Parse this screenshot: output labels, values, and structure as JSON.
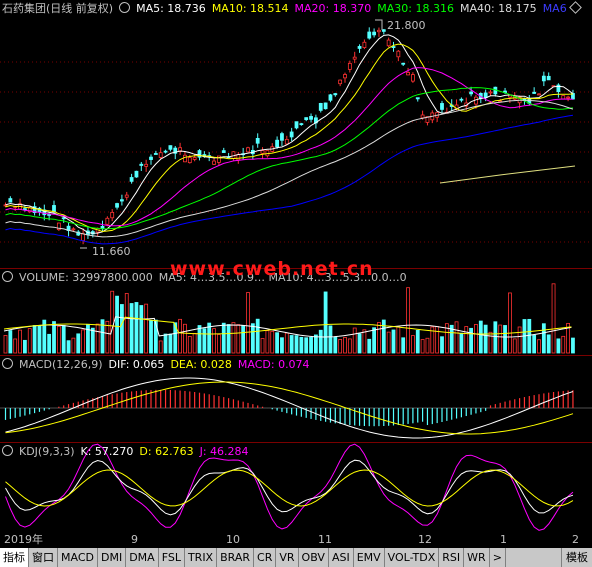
{
  "main": {
    "title": "石药集团(日线 前复权)",
    "ma5": "MA5: 18.736",
    "ma10": "MA10: 18.514",
    "ma20": "MA20: 18.370",
    "ma30": "MA30: 18.316",
    "ma40": "MA40: 18.175",
    "ma6": "MA6",
    "high_label": "21.800",
    "low_label": "11.660"
  },
  "volume": {
    "label": "VOLUME: 32997800.000",
    "rest": "MA5: 4…3.5…0.9… MA10: 4…3…5.3…0.0…0"
  },
  "macd": {
    "title": "MACD(12,26,9)",
    "dif": "DIF: 0.065",
    "dea": "DEA: 0.028",
    "macd": "MACD: 0.074"
  },
  "kdj": {
    "title": "KDJ(9,3,3)",
    "k": "K: 57.270",
    "d": "D: 62.763",
    "j": "J: 46.284"
  },
  "watermark": "www.cweb.net.cn",
  "axis": {
    "year": "2019年",
    "m9": "9",
    "m10": "10",
    "m11": "11",
    "m12": "12",
    "m1": "1",
    "m2": "2"
  },
  "tabs": [
    "指标",
    "窗口",
    "MACD",
    "DMI",
    "DMA",
    "FSL",
    "TRIX",
    "BRAR",
    "CR",
    "VR",
    "OBV",
    "ASI",
    "EMV",
    "VOL-TDX",
    "RSI",
    "WR",
    ">"
  ],
  "template_label": "模板",
  "colors": {
    "up": "#ff3232",
    "down": "#54ffff",
    "ma5": "#ffffff",
    "ma10": "#ffff00",
    "ma20": "#ff00ff",
    "ma30": "#00ff00",
    "ma40": "#dcdcdc",
    "ma60": "#0000ff"
  }
}
